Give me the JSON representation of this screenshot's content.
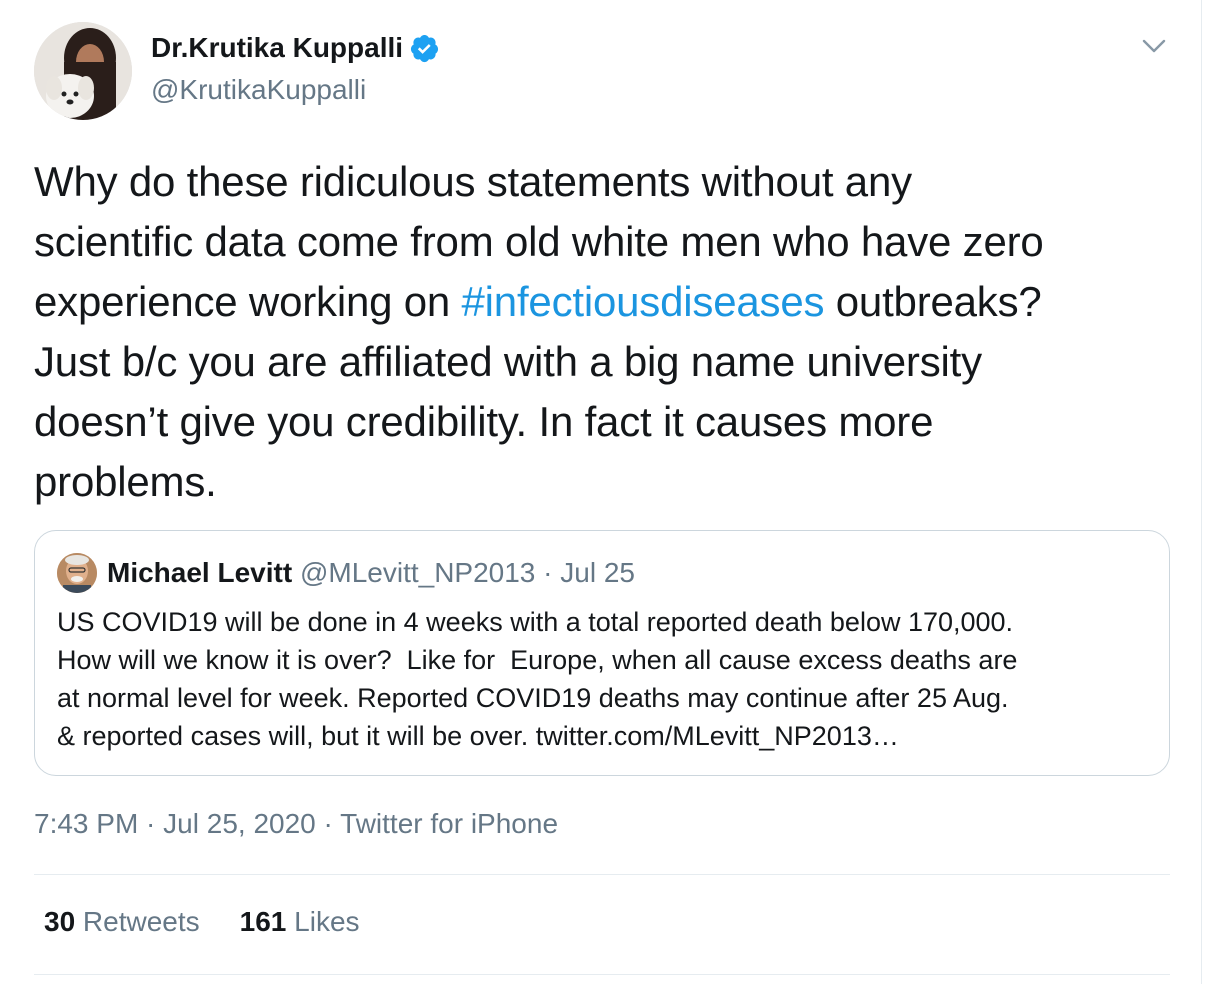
{
  "author": {
    "name": "Dr.Krutika Kuppalli",
    "handle": "@KrutikaKuppalli",
    "verified": true
  },
  "tweet": {
    "text_before_hashtag_lines": [
      "Why do these ridiculous statements without any",
      "scientific data come from old white men who have zero"
    ],
    "line3_prefix": "experience working on ",
    "hashtag": "#infectiousdiseases",
    "line3_suffix": " outbreaks?",
    "text_after_hashtag_lines": [
      "Just b/c you are affiliated with a big name university",
      "doesn’t give you credibility. In fact it causes more",
      "problems."
    ]
  },
  "quoted_tweet": {
    "name": "Michael Levitt",
    "meta": " @MLevitt_NP2013 · Jul 25",
    "lines": [
      "US COVID19 will be done in 4 weeks with a total reported death below 170,000.",
      "How will we know it is over?  Like for  Europe, when all cause excess deaths are",
      "at normal level for week. Reported COVID19 deaths may continue after 25 Aug.",
      "& reported cases will, but it will be over. twitter.com/MLevitt_NP2013…"
    ]
  },
  "meta": {
    "time": "7:43 PM",
    "separator1": " · ",
    "date": "Jul 25, 2020",
    "separator2": " · ",
    "source": "Twitter for iPhone"
  },
  "stats": {
    "retweets_count": "30",
    "retweets_label": " Retweets",
    "likes_count": "161",
    "likes_label": " Likes"
  },
  "colors": {
    "link": "#1b95e0",
    "secondary_text": "#657786",
    "primary_text": "#14171a",
    "verified_badge": "#1da1f2",
    "border": "#ccd6dd"
  },
  "icons": {
    "verified": "verified-badge-icon",
    "menu": "chevron-down-icon"
  }
}
